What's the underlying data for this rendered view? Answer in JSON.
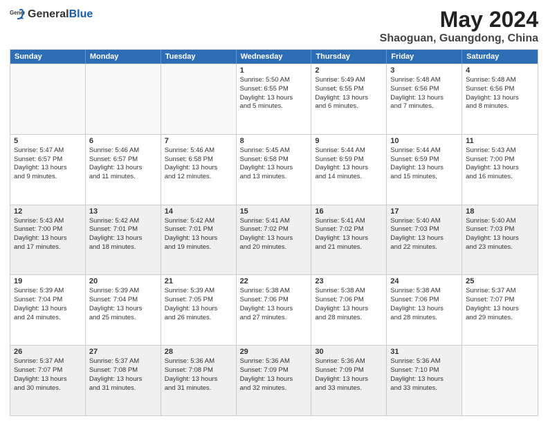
{
  "header": {
    "logo_general": "General",
    "logo_blue": "Blue",
    "title": "May 2024",
    "subtitle": "Shaoguan, Guangdong, China"
  },
  "weekdays": [
    "Sunday",
    "Monday",
    "Tuesday",
    "Wednesday",
    "Thursday",
    "Friday",
    "Saturday"
  ],
  "rows": [
    [
      {
        "day": "",
        "lines": [],
        "empty": true
      },
      {
        "day": "",
        "lines": [],
        "empty": true
      },
      {
        "day": "",
        "lines": [],
        "empty": true
      },
      {
        "day": "1",
        "lines": [
          "Sunrise: 5:50 AM",
          "Sunset: 6:55 PM",
          "Daylight: 13 hours",
          "and 5 minutes."
        ]
      },
      {
        "day": "2",
        "lines": [
          "Sunrise: 5:49 AM",
          "Sunset: 6:55 PM",
          "Daylight: 13 hours",
          "and 6 minutes."
        ]
      },
      {
        "day": "3",
        "lines": [
          "Sunrise: 5:48 AM",
          "Sunset: 6:56 PM",
          "Daylight: 13 hours",
          "and 7 minutes."
        ]
      },
      {
        "day": "4",
        "lines": [
          "Sunrise: 5:48 AM",
          "Sunset: 6:56 PM",
          "Daylight: 13 hours",
          "and 8 minutes."
        ]
      }
    ],
    [
      {
        "day": "5",
        "lines": [
          "Sunrise: 5:47 AM",
          "Sunset: 6:57 PM",
          "Daylight: 13 hours",
          "and 9 minutes."
        ]
      },
      {
        "day": "6",
        "lines": [
          "Sunrise: 5:46 AM",
          "Sunset: 6:57 PM",
          "Daylight: 13 hours",
          "and 11 minutes."
        ]
      },
      {
        "day": "7",
        "lines": [
          "Sunrise: 5:46 AM",
          "Sunset: 6:58 PM",
          "Daylight: 13 hours",
          "and 12 minutes."
        ]
      },
      {
        "day": "8",
        "lines": [
          "Sunrise: 5:45 AM",
          "Sunset: 6:58 PM",
          "Daylight: 13 hours",
          "and 13 minutes."
        ]
      },
      {
        "day": "9",
        "lines": [
          "Sunrise: 5:44 AM",
          "Sunset: 6:59 PM",
          "Daylight: 13 hours",
          "and 14 minutes."
        ]
      },
      {
        "day": "10",
        "lines": [
          "Sunrise: 5:44 AM",
          "Sunset: 6:59 PM",
          "Daylight: 13 hours",
          "and 15 minutes."
        ]
      },
      {
        "day": "11",
        "lines": [
          "Sunrise: 5:43 AM",
          "Sunset: 7:00 PM",
          "Daylight: 13 hours",
          "and 16 minutes."
        ]
      }
    ],
    [
      {
        "day": "12",
        "lines": [
          "Sunrise: 5:43 AM",
          "Sunset: 7:00 PM",
          "Daylight: 13 hours",
          "and 17 minutes."
        ],
        "shaded": true
      },
      {
        "day": "13",
        "lines": [
          "Sunrise: 5:42 AM",
          "Sunset: 7:01 PM",
          "Daylight: 13 hours",
          "and 18 minutes."
        ],
        "shaded": true
      },
      {
        "day": "14",
        "lines": [
          "Sunrise: 5:42 AM",
          "Sunset: 7:01 PM",
          "Daylight: 13 hours",
          "and 19 minutes."
        ],
        "shaded": true
      },
      {
        "day": "15",
        "lines": [
          "Sunrise: 5:41 AM",
          "Sunset: 7:02 PM",
          "Daylight: 13 hours",
          "and 20 minutes."
        ],
        "shaded": true
      },
      {
        "day": "16",
        "lines": [
          "Sunrise: 5:41 AM",
          "Sunset: 7:02 PM",
          "Daylight: 13 hours",
          "and 21 minutes."
        ],
        "shaded": true
      },
      {
        "day": "17",
        "lines": [
          "Sunrise: 5:40 AM",
          "Sunset: 7:03 PM",
          "Daylight: 13 hours",
          "and 22 minutes."
        ],
        "shaded": true
      },
      {
        "day": "18",
        "lines": [
          "Sunrise: 5:40 AM",
          "Sunset: 7:03 PM",
          "Daylight: 13 hours",
          "and 23 minutes."
        ],
        "shaded": true
      }
    ],
    [
      {
        "day": "19",
        "lines": [
          "Sunrise: 5:39 AM",
          "Sunset: 7:04 PM",
          "Daylight: 13 hours",
          "and 24 minutes."
        ]
      },
      {
        "day": "20",
        "lines": [
          "Sunrise: 5:39 AM",
          "Sunset: 7:04 PM",
          "Daylight: 13 hours",
          "and 25 minutes."
        ]
      },
      {
        "day": "21",
        "lines": [
          "Sunrise: 5:39 AM",
          "Sunset: 7:05 PM",
          "Daylight: 13 hours",
          "and 26 minutes."
        ]
      },
      {
        "day": "22",
        "lines": [
          "Sunrise: 5:38 AM",
          "Sunset: 7:06 PM",
          "Daylight: 13 hours",
          "and 27 minutes."
        ]
      },
      {
        "day": "23",
        "lines": [
          "Sunrise: 5:38 AM",
          "Sunset: 7:06 PM",
          "Daylight: 13 hours",
          "and 28 minutes."
        ]
      },
      {
        "day": "24",
        "lines": [
          "Sunrise: 5:38 AM",
          "Sunset: 7:06 PM",
          "Daylight: 13 hours",
          "and 28 minutes."
        ]
      },
      {
        "day": "25",
        "lines": [
          "Sunrise: 5:37 AM",
          "Sunset: 7:07 PM",
          "Daylight: 13 hours",
          "and 29 minutes."
        ]
      }
    ],
    [
      {
        "day": "26",
        "lines": [
          "Sunrise: 5:37 AM",
          "Sunset: 7:07 PM",
          "Daylight: 13 hours",
          "and 30 minutes."
        ],
        "shaded": true
      },
      {
        "day": "27",
        "lines": [
          "Sunrise: 5:37 AM",
          "Sunset: 7:08 PM",
          "Daylight: 13 hours",
          "and 31 minutes."
        ],
        "shaded": true
      },
      {
        "day": "28",
        "lines": [
          "Sunrise: 5:36 AM",
          "Sunset: 7:08 PM",
          "Daylight: 13 hours",
          "and 31 minutes."
        ],
        "shaded": true
      },
      {
        "day": "29",
        "lines": [
          "Sunrise: 5:36 AM",
          "Sunset: 7:09 PM",
          "Daylight: 13 hours",
          "and 32 minutes."
        ],
        "shaded": true
      },
      {
        "day": "30",
        "lines": [
          "Sunrise: 5:36 AM",
          "Sunset: 7:09 PM",
          "Daylight: 13 hours",
          "and 33 minutes."
        ],
        "shaded": true
      },
      {
        "day": "31",
        "lines": [
          "Sunrise: 5:36 AM",
          "Sunset: 7:10 PM",
          "Daylight: 13 hours",
          "and 33 minutes."
        ],
        "shaded": true
      },
      {
        "day": "",
        "lines": [],
        "empty": true,
        "shaded": true
      }
    ]
  ]
}
